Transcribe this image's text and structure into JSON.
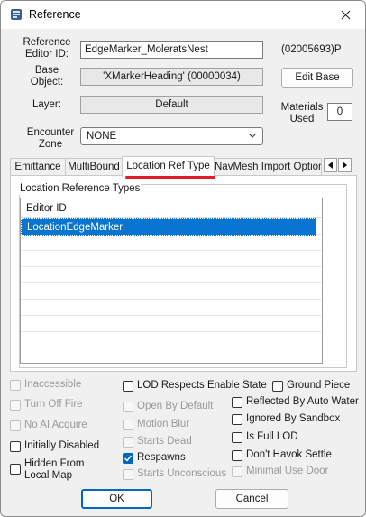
{
  "window": {
    "title": "Reference"
  },
  "header": {
    "editor_id_label": "Reference\nEditor ID:",
    "editor_id_value": "EdgeMarker_MoleratsNest",
    "form_id": "(02005693)P",
    "base_object_label": "Base\nObject:",
    "base_object_value": "'XMarkerHeading' (00000034)",
    "edit_base_label": "Edit Base",
    "layer_label": "Layer:",
    "layer_value": "Default",
    "materials_used_label": "Materials\nUsed",
    "materials_used_value": "0",
    "encounter_zone_label": "Encounter\nZone",
    "encounter_zone_value": "NONE"
  },
  "tabs": [
    "Emittance",
    "MultiBound",
    "Location Ref Type",
    "NavMesh Import Option"
  ],
  "active_tab": "Location Ref Type",
  "panel": {
    "group_title": "Location Reference Types",
    "column_header": "Editor ID",
    "rows": [
      "LocationEdgeMarker"
    ]
  },
  "checkboxes": {
    "inaccessible": "Inaccessible",
    "turn_off_fire": "Turn Off Fire",
    "no_ai_acquire": "No AI Acquire",
    "initially_disabled": "Initially Disabled",
    "hidden_from_local_map": "Hidden From Local Map",
    "lod_respects_enable_state": "LOD Respects Enable State",
    "ground_piece": "Ground Piece",
    "open_by_default": "Open By Default",
    "reflected_by_auto_water": "Reflected By Auto Water",
    "motion_blur": "Motion Blur",
    "ignored_by_sandbox": "Ignored By Sandbox",
    "starts_dead": "Starts Dead",
    "is_full_lod": "Is Full LOD",
    "respawns": "Respawns",
    "dont_havok_settle": "Don't Havok Settle",
    "starts_unconscious": "Starts Unconscious",
    "minimal_use_door": "Minimal Use Door"
  },
  "footer": {
    "ok_label": "OK",
    "cancel_label": "Cancel"
  },
  "colors": {
    "selection": "#0a74d1",
    "accent": "#0067c0",
    "tab_highlight": "#e31c23"
  }
}
